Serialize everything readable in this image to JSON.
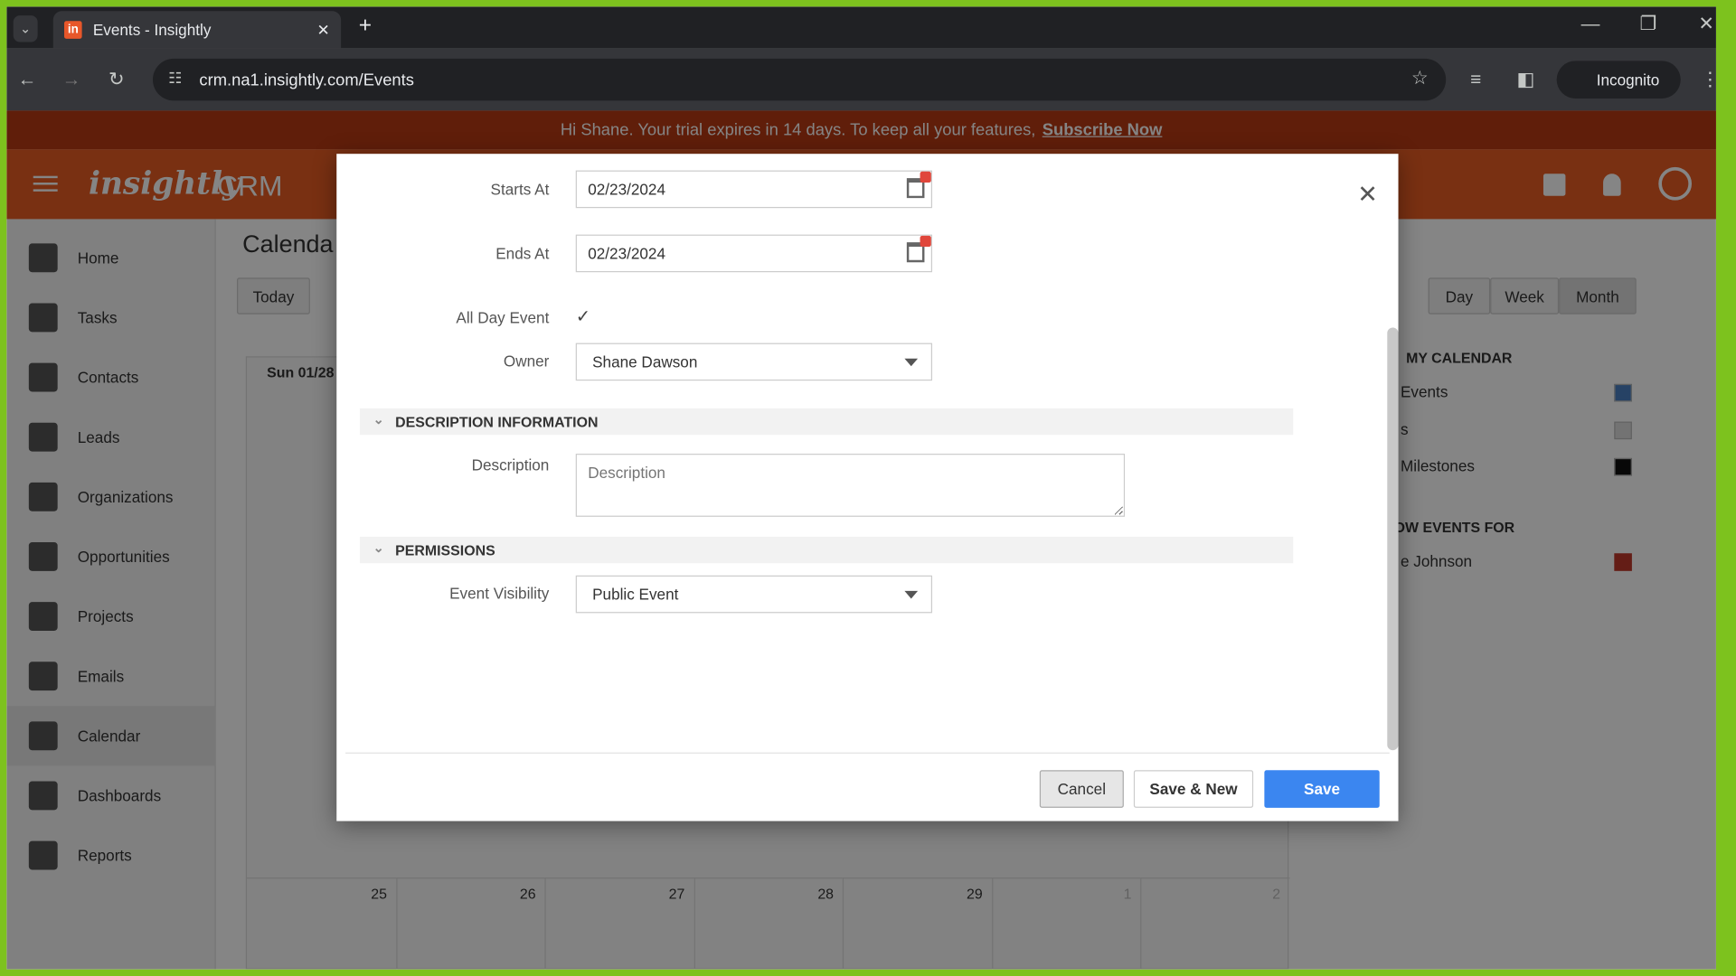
{
  "browser": {
    "tab_title": "Events - Insightly",
    "url": "crm.na1.insightly.com/Events",
    "profile": "Incognito"
  },
  "banner": {
    "text": "Hi Shane. Your trial expires in 14 days. To keep all your features,",
    "link": "Subscribe Now"
  },
  "app": {
    "logo": "insightly",
    "product": "CRM"
  },
  "sidebar": {
    "items": [
      {
        "label": "Home"
      },
      {
        "label": "Tasks"
      },
      {
        "label": "Contacts"
      },
      {
        "label": "Leads"
      },
      {
        "label": "Organizations"
      },
      {
        "label": "Opportunities"
      },
      {
        "label": "Projects"
      },
      {
        "label": "Emails"
      },
      {
        "label": "Calendar"
      },
      {
        "label": "Dashboards"
      },
      {
        "label": "Reports"
      }
    ]
  },
  "calendar": {
    "title": "Calenda",
    "today": "Today",
    "views": [
      "Day",
      "Week",
      "Month"
    ],
    "header_cell": "Sun 01/28",
    "row_dates": [
      "25",
      "26",
      "27",
      "28",
      "29",
      "1",
      "2"
    ],
    "panel": {
      "my_calendar": "MY CALENDAR",
      "items": [
        {
          "label": "Events",
          "color": "#4a7fc1"
        },
        {
          "label": "s",
          "color": "#dddddd"
        },
        {
          "label": "Milestones",
          "color": "#111111"
        }
      ],
      "show_for": "OW EVENTS FOR",
      "users": [
        {
          "label": "e Johnson",
          "color": "#c0392b"
        }
      ]
    }
  },
  "modal": {
    "starts_at": {
      "label": "Starts At",
      "value": "02/23/2024"
    },
    "ends_at": {
      "label": "Ends At",
      "value": "02/23/2024"
    },
    "all_day": {
      "label": "All Day Event",
      "checked": true
    },
    "owner": {
      "label": "Owner",
      "value": "Shane Dawson"
    },
    "desc_section": "DESCRIPTION INFORMATION",
    "description": {
      "label": "Description",
      "placeholder": "Description",
      "value": ""
    },
    "perm_section": "PERMISSIONS",
    "visibility": {
      "label": "Event Visibility",
      "value": "Public Event"
    },
    "buttons": {
      "cancel": "Cancel",
      "save_new": "Save & New",
      "save": "Save"
    },
    "save_color": "#3b86f0"
  }
}
